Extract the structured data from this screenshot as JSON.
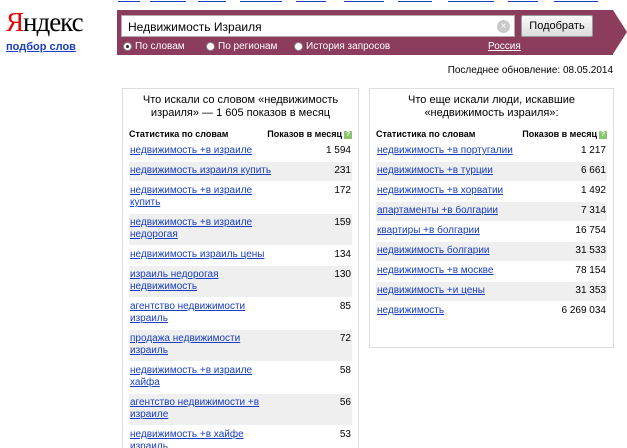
{
  "logo": {
    "first": "Я",
    "rest": "ндекс",
    "sub": "подбор слов"
  },
  "search": {
    "query": "Недвижимость Израиля",
    "submit_label": "Подобрать",
    "modes": [
      {
        "label": "По словам",
        "checked": true
      },
      {
        "label": "По регионам",
        "checked": false
      },
      {
        "label": "История запросов",
        "checked": false
      }
    ],
    "region": "Россия"
  },
  "updated": "Последнее обновление: 08.05.2014",
  "left": {
    "title": "Что искали со словом «недвижимость израиля» — 1 605 показов в месяц",
    "col_keyword": "Статистика по словам",
    "col_count": "Показов в месяц",
    "rows": [
      {
        "kw": "недвижимость +в израиле",
        "cnt": "1 594"
      },
      {
        "kw": "недвижимость израиля купить",
        "cnt": "231"
      },
      {
        "kw": "недвижимость +в израиле купить",
        "cnt": "172"
      },
      {
        "kw": "недвижимость +в израиле недорогая",
        "cnt": "159"
      },
      {
        "kw": "недвижимость израиль цены",
        "cnt": "134"
      },
      {
        "kw": "израиль недорогая недвижимость",
        "cnt": "130"
      },
      {
        "kw": "агентство недвижимости израиль",
        "cnt": "85"
      },
      {
        "kw": "продажа недвижимости израиль",
        "cnt": "72"
      },
      {
        "kw": "недвижимость +в израиле хайфа",
        "cnt": "58"
      },
      {
        "kw": "агентство недвижимости +в израиле",
        "cnt": "56"
      },
      {
        "kw": "недвижимость +в хайфе израиль",
        "cnt": "53"
      }
    ]
  },
  "right": {
    "title": "Что еще искали люди, искавшие «недвижимость израиля»:",
    "col_keyword": "Статистика по словам",
    "col_count": "Показов в месяц",
    "rows": [
      {
        "kw": "недвижимость +в португалии",
        "cnt": "1 217"
      },
      {
        "kw": "недвижимость +в турции",
        "cnt": "6 661"
      },
      {
        "kw": "недвижимость +в хорватии",
        "cnt": "1 492"
      },
      {
        "kw": "апартаменты +в болгарии",
        "cnt": "7 314"
      },
      {
        "kw": "квартиры +в болгарии",
        "cnt": "16 754"
      },
      {
        "kw": "недвижимость болгарии",
        "cnt": "31 533"
      },
      {
        "kw": "недвижимость +в москве",
        "cnt": "78 154"
      },
      {
        "kw": "недвижимость +и цены",
        "cnt": "31 353"
      },
      {
        "kw": "недвижимость",
        "cnt": "6 269 034"
      }
    ]
  }
}
